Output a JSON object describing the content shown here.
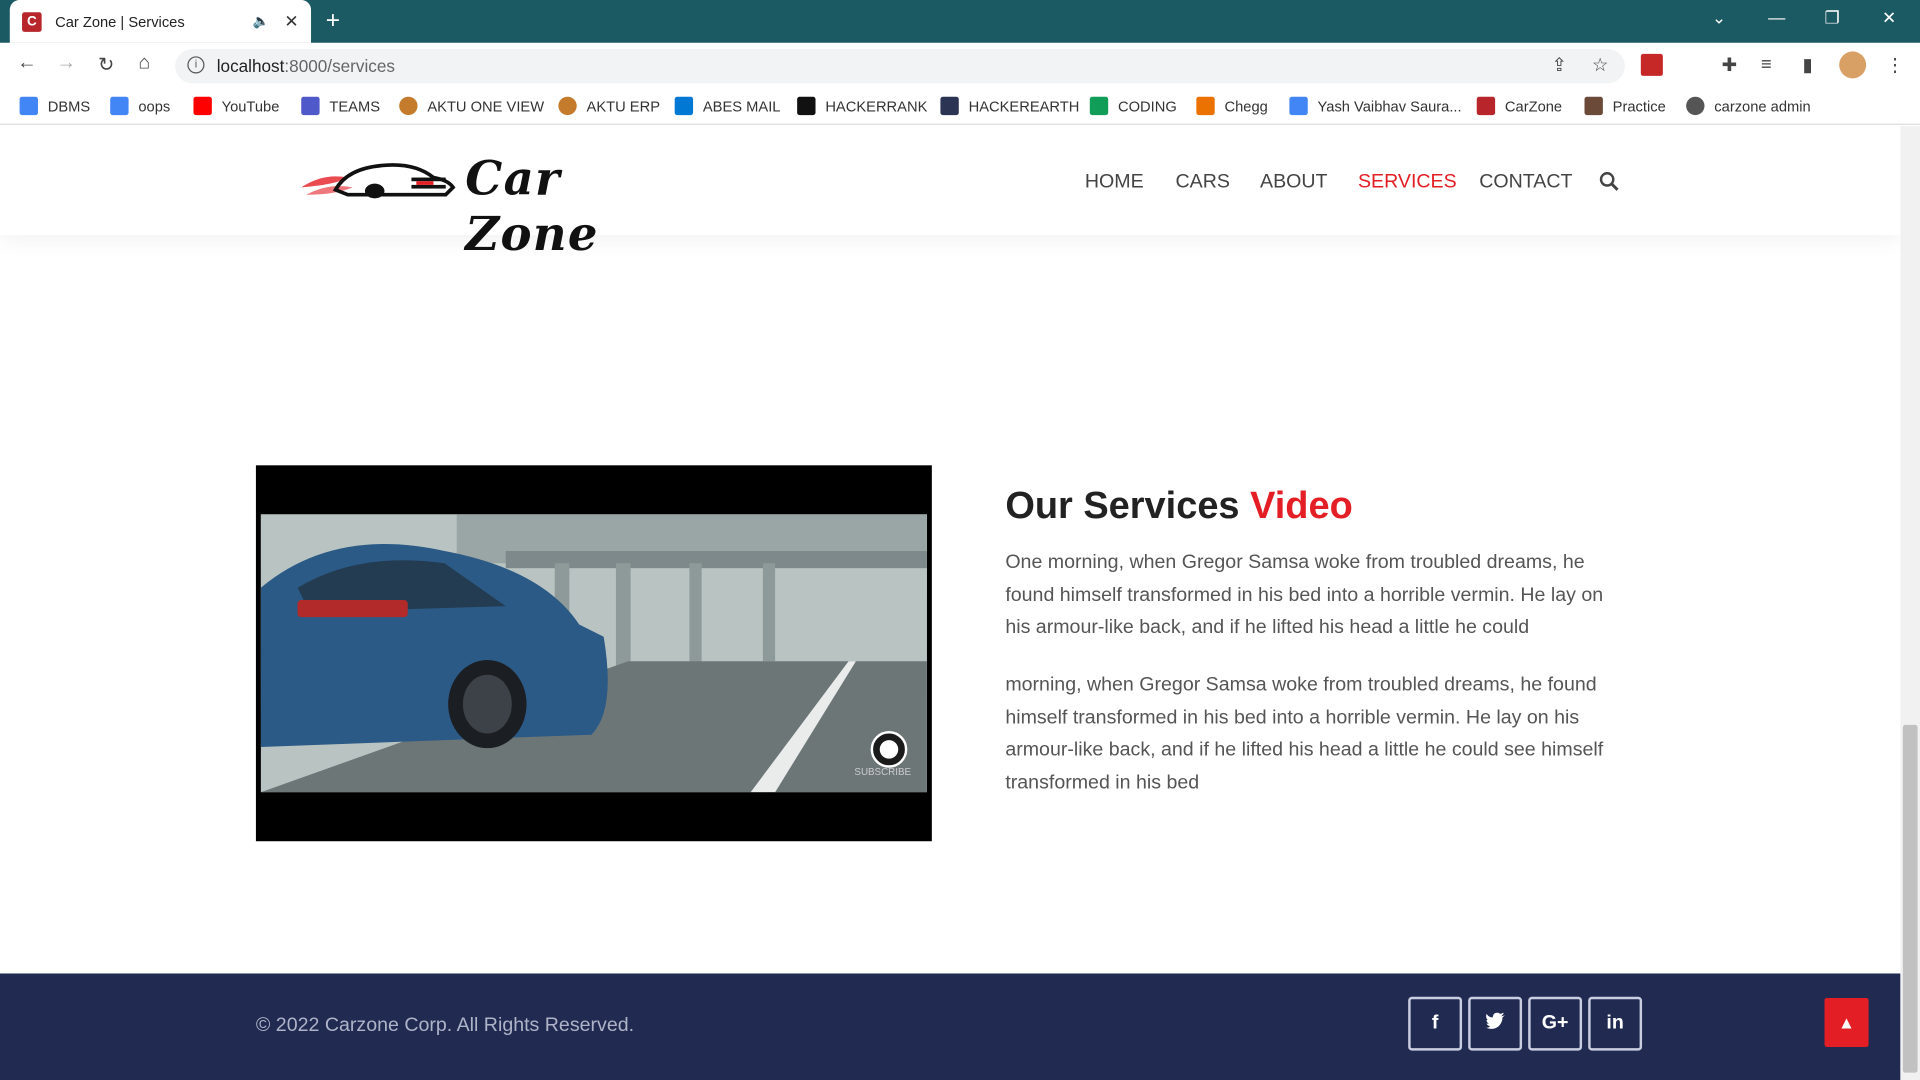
{
  "browser": {
    "tab_title": "Car Zone | Services",
    "tab_favicon": "C",
    "url_host": "localhost",
    "url_path": ":8000/services",
    "bookmarks": [
      {
        "label": "DBMS",
        "color": "#4285f4"
      },
      {
        "label": "oops",
        "color": "#4285f4"
      },
      {
        "label": "YouTube",
        "color": "#ff0000"
      },
      {
        "label": "TEAMS",
        "color": "#5059c9"
      },
      {
        "label": "AKTU ONE VIEW",
        "color": "#c47b2b"
      },
      {
        "label": "AKTU ERP",
        "color": "#c47b2b"
      },
      {
        "label": "ABES MAIL",
        "color": "#0078d4"
      },
      {
        "label": "HACKERRANK",
        "color": "#111111"
      },
      {
        "label": "HACKEREARTH",
        "color": "#2c3454"
      },
      {
        "label": "CODING",
        "color": "#0f9d58"
      },
      {
        "label": "Chegg",
        "color": "#eb7100"
      },
      {
        "label": "Yash Vaibhav Saura...",
        "color": "#4285f4"
      },
      {
        "label": "CarZone",
        "color": "#b8262b"
      },
      {
        "label": "Practice",
        "color": "#6b4a3a"
      },
      {
        "label": "carzone admin",
        "color": "#555555"
      }
    ]
  },
  "site": {
    "logo_text": "Car Zone",
    "nav": [
      "HOME",
      "CARS",
      "ABOUT",
      "SERVICES",
      "CONTACT"
    ],
    "active_nav": "SERVICES",
    "accent_color": "#e31e24"
  },
  "services": {
    "title_main": "Our Services",
    "title_accent": "Video",
    "paragraph1": "One morning, when Gregor Samsa woke from troubled dreams, he found himself transformed in his bed into a horrible vermin. He lay on his armour-like back, and if he lifted his head a little he could",
    "paragraph2": "morning, when Gregor Samsa woke from troubled dreams, he found himself transformed in his bed into a horrible vermin. He lay on his armour-like back, and if he lifted his head a little he could see himself transformed in his bed",
    "video_badge": "SUBSCRIBE"
  },
  "footer": {
    "copyright": "© 2022 Carzone Corp. All Rights Reserved.",
    "social": [
      {
        "icon": "facebook-icon",
        "glyph": "f"
      },
      {
        "icon": "twitter-icon",
        "glyph": "🐦"
      },
      {
        "icon": "google-plus-icon",
        "glyph": "G+"
      },
      {
        "icon": "linkedin-icon",
        "glyph": "in"
      }
    ],
    "back_to_top_icon": "chevron-up-icon"
  }
}
